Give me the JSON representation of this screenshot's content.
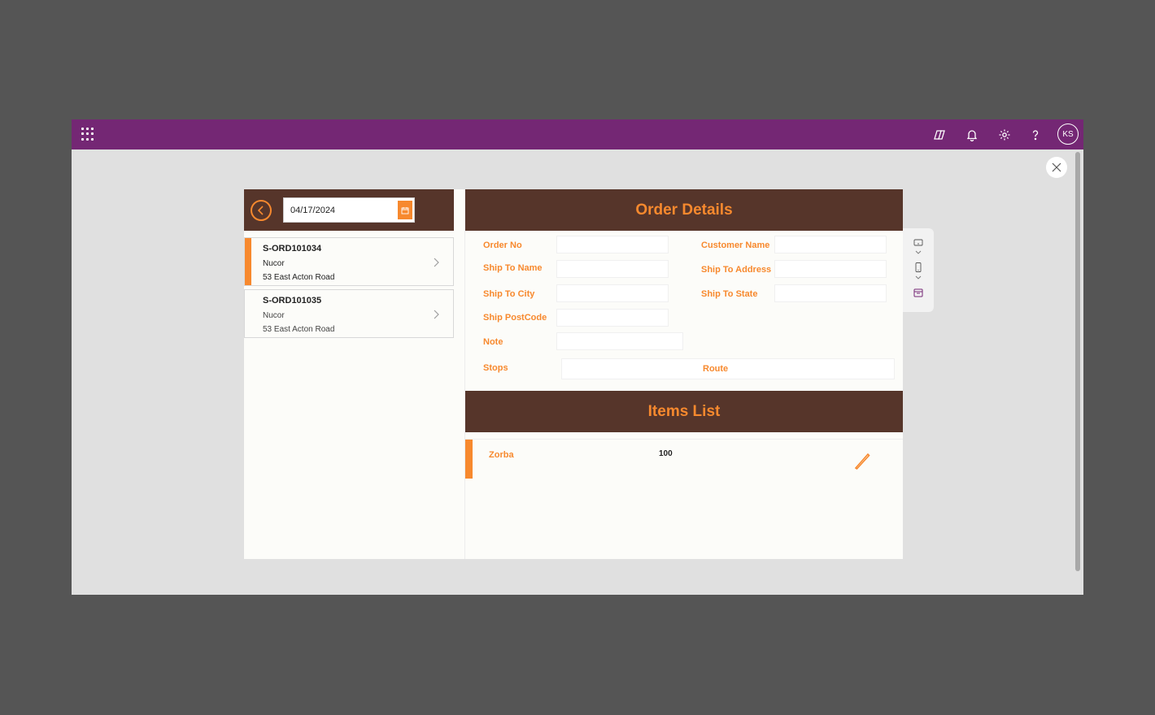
{
  "topbar": {
    "icons": [
      "waffle-icon",
      "copilot-icon",
      "bell-icon",
      "gear-icon",
      "help-icon"
    ],
    "avatar_initials": "KS"
  },
  "date_filter": {
    "value": "04/17/2024"
  },
  "orders": [
    {
      "id": "S-ORD101034",
      "customer": "Nucor",
      "address": "53 East Acton Road",
      "selected": true
    },
    {
      "id": "S-ORD101035",
      "customer": "Nucor",
      "address": "53 East Acton Road",
      "selected": false
    }
  ],
  "order_details": {
    "title": "Order Details",
    "fields": {
      "order_no": "Order No",
      "customer_name": "Customer Name",
      "ship_to_name": "Ship To Name",
      "ship_to_address": "Ship To Address",
      "ship_to_city": "Ship To City",
      "ship_to_state": "Ship To State",
      "ship_postcode": "Ship PostCode",
      "note": "Note",
      "stops": "Stops",
      "route": "Route"
    }
  },
  "items_list": {
    "title": "Items List",
    "items": [
      {
        "name": "Zorba",
        "quantity": "100"
      }
    ]
  },
  "colors": {
    "brand_purple": "#742774",
    "header_brown": "#56352a",
    "accent_orange": "#f7892e"
  }
}
